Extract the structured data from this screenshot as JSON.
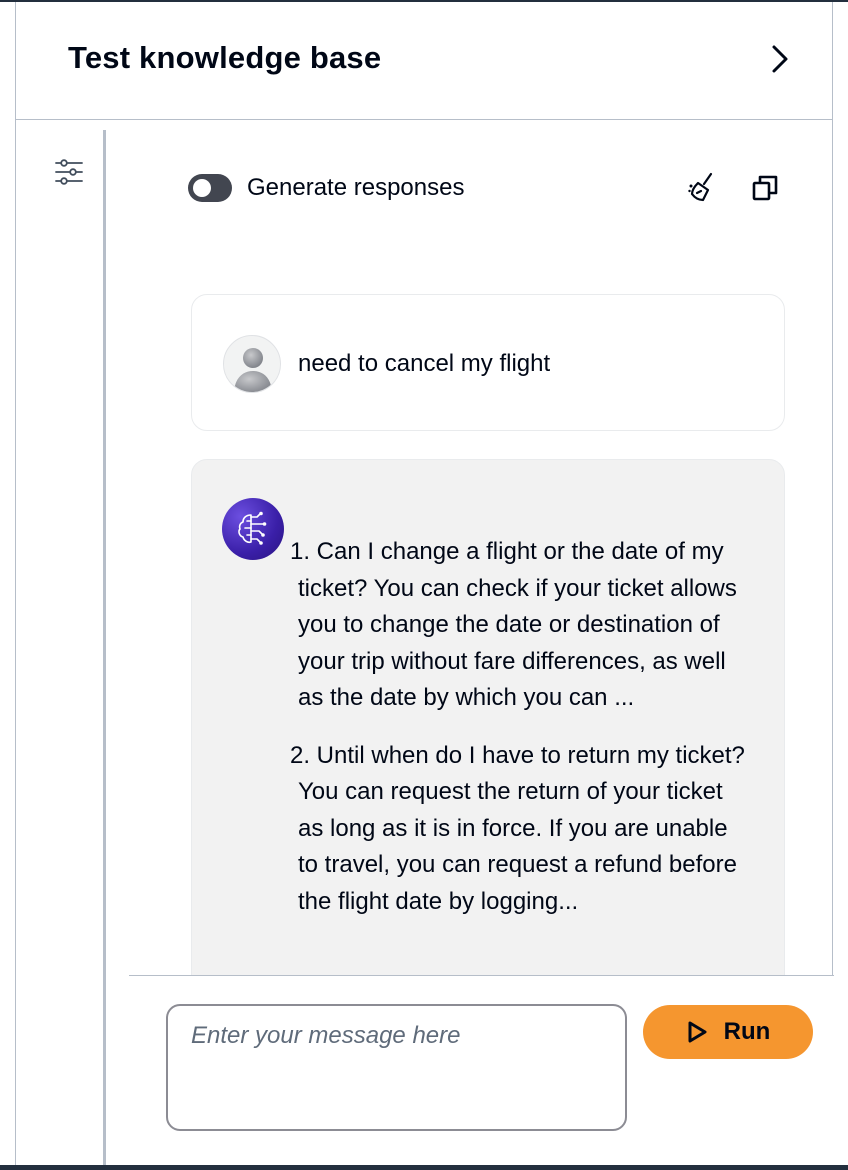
{
  "header": {
    "title": "Test knowledge base",
    "collapse_icon": "chevron-right-icon"
  },
  "toolbar": {
    "settings_icon": "sliders-icon",
    "generate_toggle_label": "Generate responses",
    "generate_toggle_on": false,
    "clear_icon": "broom-icon",
    "copy_icon": "copy-icon"
  },
  "conversation": {
    "user_message": "need to cancel my flight",
    "ai_results": [
      "1. Can I change a flight or the date of my ticket? You can check if your ticket allows you to change the date or destination of your trip without fare differences, as well as the date by which you can ...",
      "2. Until when do I have to return my ticket? You can request the return of your ticket as long as it is in force. If you are unable to travel, you can request a refund before the flight date by logging..."
    ]
  },
  "composer": {
    "placeholder": "Enter your message here",
    "value": "",
    "run_label": "Run"
  },
  "colors": {
    "accent_orange": "#f5962f",
    "toggle_off": "#424650",
    "ai_bubble_bg": "#f2f2f2",
    "ai_avatar": "#3a1fa8"
  }
}
